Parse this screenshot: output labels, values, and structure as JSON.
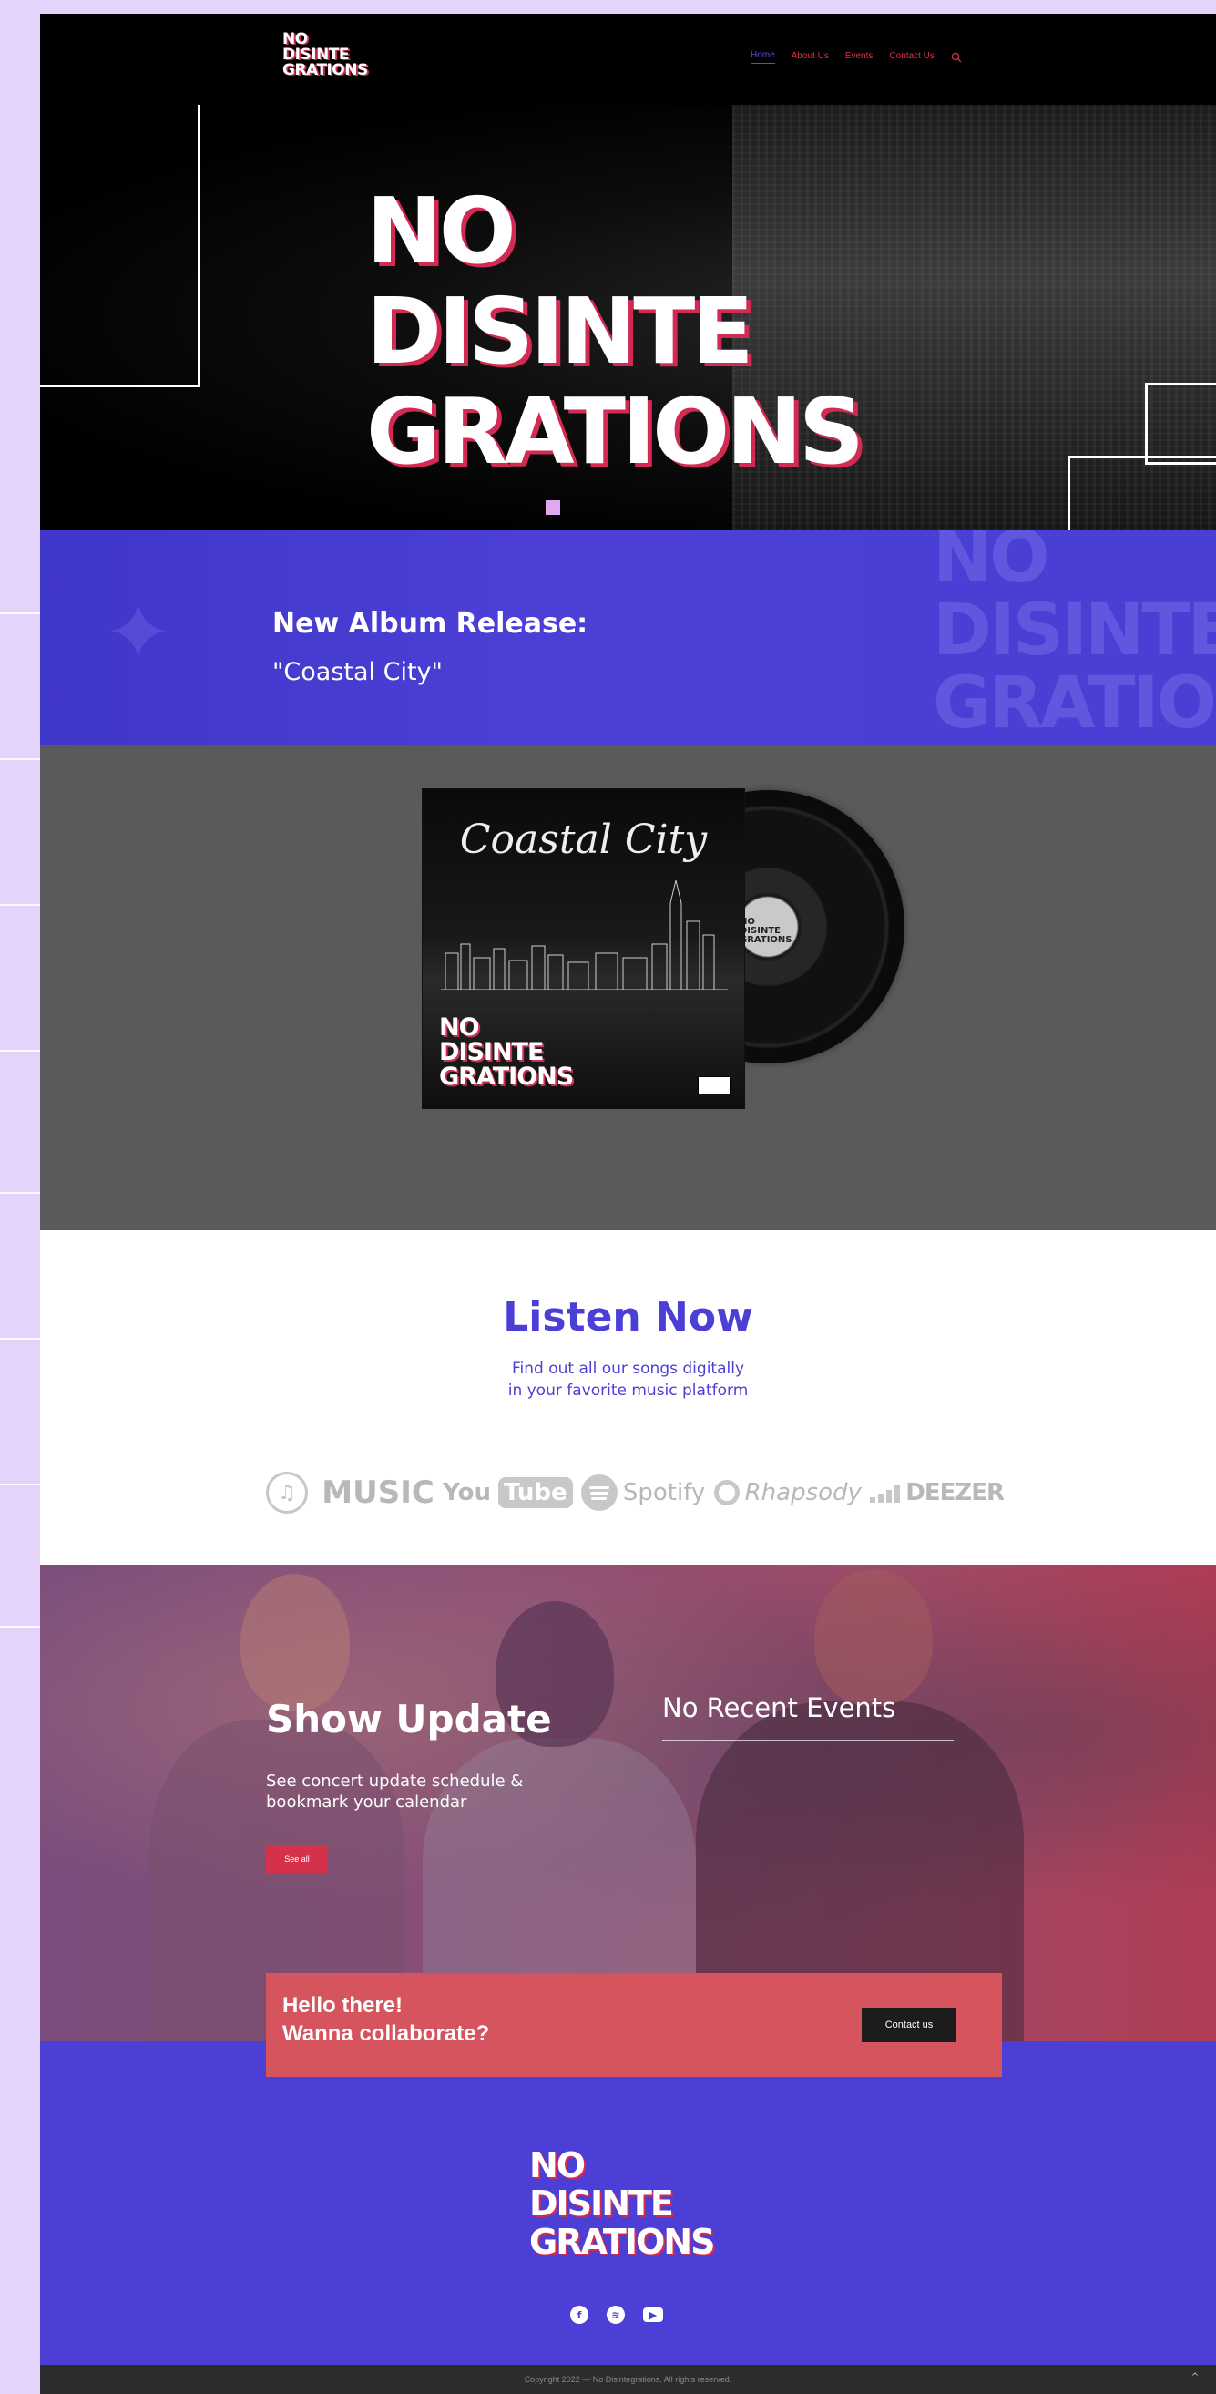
{
  "header": {
    "brand_lines": [
      "NO",
      "DISINTE",
      "GRATIONS"
    ],
    "nav": [
      {
        "label": "Home",
        "active": true
      },
      {
        "label": "About Us",
        "active": false
      },
      {
        "label": "Events",
        "active": false
      },
      {
        "label": "Contact Us",
        "active": false
      }
    ],
    "search_icon": "search-icon"
  },
  "hero": {
    "title_lines": [
      "NO",
      "DISINTE",
      "GRATIONS"
    ],
    "accent_color": "#d22a52"
  },
  "album_banner": {
    "heading": "New Album Release:",
    "subheading": "\"Coastal City\"",
    "bg_color": "#4b3fd5"
  },
  "album_art": {
    "cover_title": "Coastal City",
    "cover_logo_lines": [
      "NO",
      "DISINTE",
      "GRATIONS"
    ],
    "vinyl_label_lines": [
      "NO",
      "DISINTE",
      "GRATIONS"
    ]
  },
  "listen": {
    "title": "Listen Now",
    "subtitle_lines": [
      "Find out all our songs digitally",
      "in your favorite music platform"
    ],
    "platforms": [
      {
        "name": "MUSIC",
        "icon": "itunes-icon"
      },
      {
        "name": "You",
        "extra": "Tube",
        "icon": "youtube-logo"
      },
      {
        "name": "Spotify",
        "icon": "spotify-icon"
      },
      {
        "name": "Rhapsody",
        "icon": "rhapsody-icon"
      },
      {
        "name": "DEEZER",
        "icon": "deezer-icon"
      }
    ]
  },
  "show": {
    "title": "Show Update",
    "subtitle_lines": [
      "See concert update schedule &",
      "bookmark your calendar"
    ],
    "see_all_label": "See all",
    "no_events": "No Recent Events"
  },
  "collab": {
    "lines": [
      "Hello there!",
      "Wanna collaborate?"
    ],
    "contact_label": "Contact us",
    "bg_color": "#d6545d"
  },
  "footer": {
    "logo_lines": [
      "NO",
      "DISINTE",
      "GRATIONS"
    ],
    "socials": [
      {
        "icon": "facebook-icon",
        "glyph": "f"
      },
      {
        "icon": "spotify-icon",
        "glyph": "≋"
      },
      {
        "icon": "youtube-icon",
        "glyph": "▶"
      },
      {
        "icon": "apple-icon",
        "glyph": ""
      }
    ],
    "copyright": "Copyright 2022 — No Disintegrations. All rights reserved.",
    "to_top": "^"
  }
}
